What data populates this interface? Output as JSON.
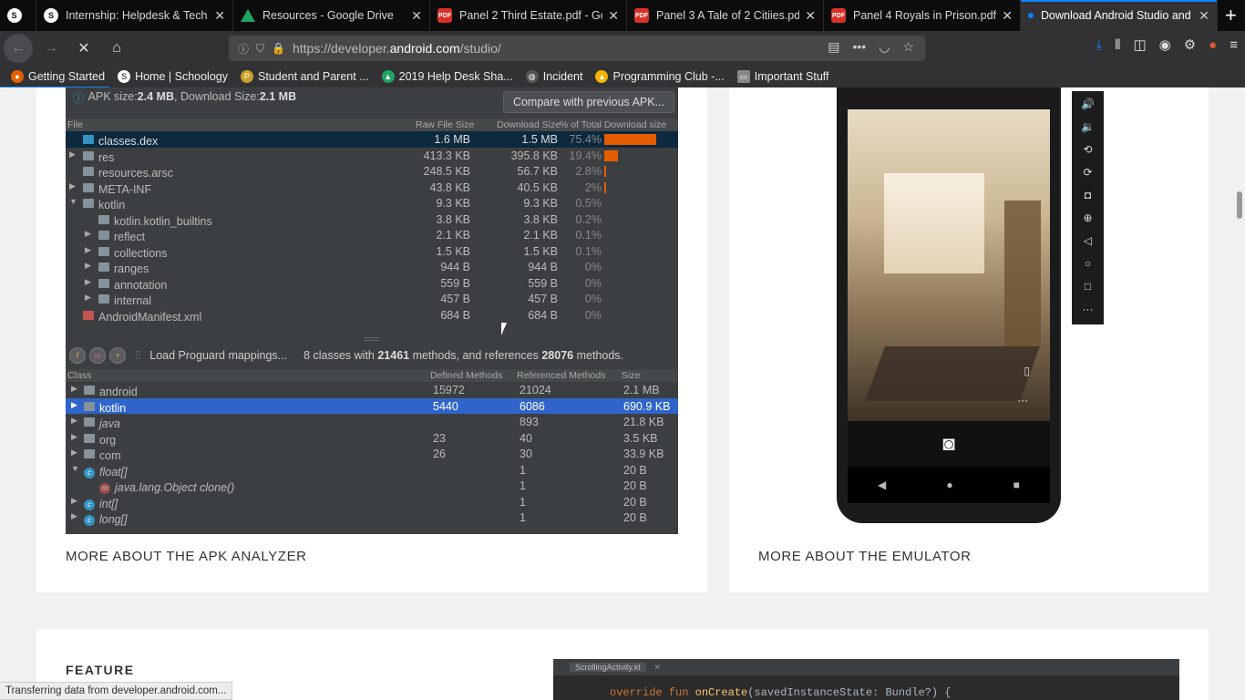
{
  "tabs": [
    {
      "title": "Internship: Helpdesk & Tech I",
      "icon": "schoology-icon"
    },
    {
      "title": "Resources - Google Drive",
      "icon": "drive-icon"
    },
    {
      "title": "Panel 2 Third Estate.pdf - Go",
      "icon": "pdf-icon"
    },
    {
      "title": "Panel 3 A Tale of 2 Citiies.pdf",
      "icon": "pdf-icon"
    },
    {
      "title": "Panel 4 Royals in Prison.pdf -",
      "icon": "pdf-icon"
    },
    {
      "title": "Download Android Studio and",
      "icon": "loading-dot-icon",
      "active": true
    }
  ],
  "url": {
    "prefix": "https://developer.",
    "domain": "android.com",
    "path": "/studio/"
  },
  "bookmarks": [
    "Getting Started",
    "Home | Schoology",
    "Student and Parent ...",
    "2019 Help Desk Sha...",
    "Incident",
    "Programming Club -...",
    "Important Stuff"
  ],
  "apk": {
    "info_prefix": "APK size: ",
    "apk_size": "2.4 MB",
    "info_mid": ", Download Size: ",
    "download_size": "2.1 MB",
    "compare_button": "Compare with previous APK...",
    "headers": {
      "file": "File",
      "raw": "Raw File Size",
      "download": "Download Size",
      "pct": "% of Total Download size"
    },
    "files": [
      {
        "name": "classes.dex",
        "raw": "1.6 MB",
        "dl": "1.5 MB",
        "pct": "75.4%",
        "share": 75.4
      },
      {
        "name": "res",
        "raw": "413.3 KB",
        "dl": "395.8 KB",
        "pct": "19.4%",
        "share": 19.4
      },
      {
        "name": "resources.arsc",
        "raw": "248.5 KB",
        "dl": "56.7 KB",
        "pct": "2.8%",
        "share": 2.8
      },
      {
        "name": "META-INF",
        "raw": "43.8 KB",
        "dl": "40.5 KB",
        "pct": "2%",
        "share": 2
      },
      {
        "name": "kotlin",
        "raw": "9.3 KB",
        "dl": "9.3 KB",
        "pct": "0.5%",
        "share": 0.5
      },
      {
        "name": "kotlin.kotlin_builtins",
        "raw": "3.8 KB",
        "dl": "3.8 KB",
        "pct": "0.2%",
        "share": 0.2
      },
      {
        "name": "reflect",
        "raw": "2.1 KB",
        "dl": "2.1 KB",
        "pct": "0.1%",
        "share": 0.1
      },
      {
        "name": "collections",
        "raw": "1.5 KB",
        "dl": "1.5 KB",
        "pct": "0.1%",
        "share": 0.1
      },
      {
        "name": "ranges",
        "raw": "944 B",
        "dl": "944 B",
        "pct": "0%",
        "share": 0
      },
      {
        "name": "annotation",
        "raw": "559 B",
        "dl": "559 B",
        "pct": "0%",
        "share": 0
      },
      {
        "name": "internal",
        "raw": "457 B",
        "dl": "457 B",
        "pct": "0%",
        "share": 0
      },
      {
        "name": "AndroidManifest.xml",
        "raw": "684 B",
        "dl": "684 B",
        "pct": "0%",
        "share": 0
      }
    ],
    "proguard": "Load Proguard mappings...",
    "summary_prefix": "8 classes with ",
    "methods": "21461",
    "summary_mid": " methods, and references ",
    "refs": "28076",
    "summary_suffix": " methods.",
    "class_headers": {
      "class": "Class",
      "defined": "Defined Methods",
      "referenced": "Referenced Methods",
      "size": "Size"
    },
    "classes": [
      {
        "name": "android",
        "def": "15972",
        "ref": "21024",
        "size": "2.1 MB"
      },
      {
        "name": "kotlin",
        "def": "5440",
        "ref": "6086",
        "size": "690.9 KB"
      },
      {
        "name": "java",
        "def": "",
        "ref": "893",
        "size": "21.8 KB"
      },
      {
        "name": "org",
        "def": "23",
        "ref": "40",
        "size": "3.5 KB"
      },
      {
        "name": "com",
        "def": "26",
        "ref": "30",
        "size": "33.9 KB"
      },
      {
        "name": "float[]",
        "def": "",
        "ref": "1",
        "size": "20 B"
      },
      {
        "name": "java.lang.Object clone()",
        "def": "",
        "ref": "1",
        "size": "20 B"
      },
      {
        "name": "int[]",
        "def": "",
        "ref": "1",
        "size": "20 B"
      },
      {
        "name": "long[]",
        "def": "",
        "ref": "1",
        "size": "20 B"
      }
    ]
  },
  "more_apk": "MORE ABOUT THE APK ANALYZER",
  "more_emulator": "MORE ABOUT THE EMULATOR",
  "feature_label": "FEATURE",
  "code": {
    "tab": "ScrollingActivity.kt",
    "kw1": "override fun ",
    "fn": "onCreate",
    "rest": "(savedInstanceState: Bundle?) {"
  },
  "status_text": "Transferring data from developer.android.com...",
  "accent": "#0a84ff",
  "bar_color": "#e65c00"
}
